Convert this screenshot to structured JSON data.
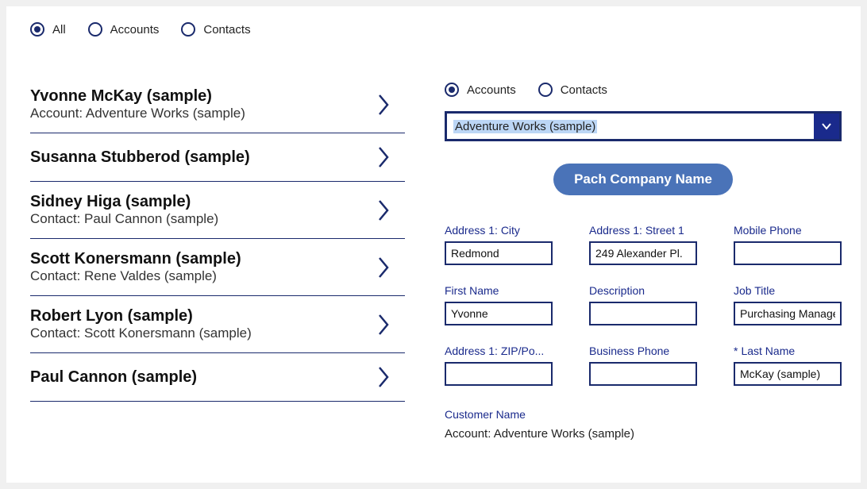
{
  "topFilters": {
    "all": "All",
    "accounts": "Accounts",
    "contacts": "Contacts",
    "selected": "all"
  },
  "list": [
    {
      "title": "Yvonne McKay (sample)",
      "sub": "Account: Adventure Works (sample)"
    },
    {
      "title": "Susanna Stubberod (sample)",
      "sub": ""
    },
    {
      "title": "Sidney Higa (sample)",
      "sub": "Contact: Paul Cannon (sample)"
    },
    {
      "title": "Scott Konersmann (sample)",
      "sub": "Contact: Rene Valdes (sample)"
    },
    {
      "title": "Robert Lyon (sample)",
      "sub": "Contact: Scott Konersmann (sample)"
    },
    {
      "title": "Paul Cannon (sample)",
      "sub": ""
    }
  ],
  "detail": {
    "radios": {
      "accounts": "Accounts",
      "contacts": "Contacts",
      "selected": "accounts"
    },
    "dropdown": "Adventure Works (sample)",
    "actionButton": "Pach Company Name",
    "fields": {
      "city": {
        "label": "Address 1: City",
        "value": "Redmond"
      },
      "street": {
        "label": "Address 1: Street 1",
        "value": "249 Alexander Pl."
      },
      "mobile": {
        "label": "Mobile Phone",
        "value": ""
      },
      "firstName": {
        "label": "First Name",
        "value": "Yvonne"
      },
      "desc": {
        "label": "Description",
        "value": ""
      },
      "jobTitle": {
        "label": "Job Title",
        "value": "Purchasing Manager"
      },
      "zip": {
        "label": "Address 1: ZIP/Po...",
        "value": ""
      },
      "bizPhone": {
        "label": "Business Phone",
        "value": ""
      },
      "lastName": {
        "label": "Last Name",
        "value": "McKay (sample)",
        "required": true
      }
    },
    "customer": {
      "label": "Customer Name",
      "value": "Account: Adventure Works (sample)"
    }
  }
}
